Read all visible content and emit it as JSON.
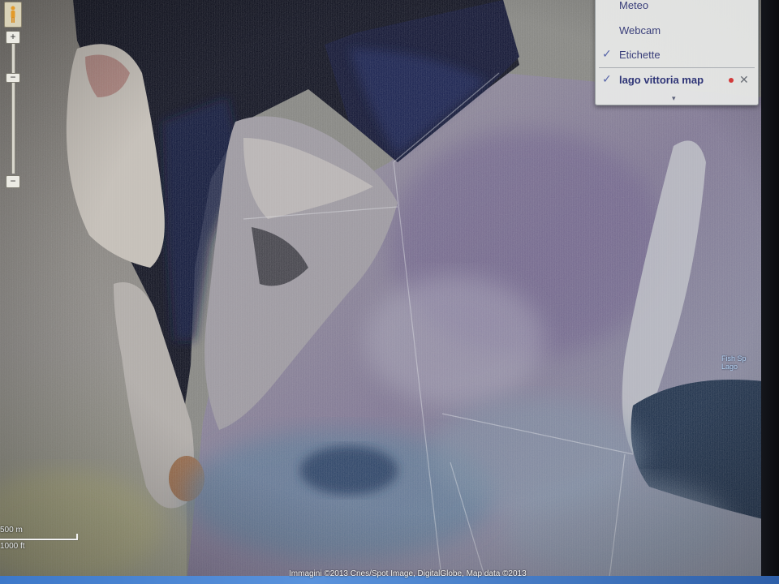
{
  "map": {
    "type": "satellite",
    "place_label": {
      "line1": "Fish Sp",
      "line2": "Lago"
    },
    "scale": {
      "top": "500 m",
      "bottom": "1000 ft"
    },
    "copyright": "Immagini ©2013 Cnes/Spot Image, DigitalGlobe, Map data ©2013"
  },
  "layers_menu": {
    "items": [
      {
        "label": "Meteo",
        "checked": false
      },
      {
        "label": "Webcam",
        "checked": false
      },
      {
        "label": "Etichette",
        "checked": true
      }
    ],
    "my_map": {
      "label": "lago vittoria map",
      "checked": true
    },
    "expand_glyph": "▾",
    "check_glyph": "✓",
    "remove_glyph": "✕"
  },
  "zoom": {
    "in": "+",
    "out": "−",
    "knob": "−"
  },
  "colors": {
    "water": "#0b0d1c",
    "land": "#8d8a86",
    "accent": "#3a3f7a",
    "status_dot": "#d23a3a"
  }
}
